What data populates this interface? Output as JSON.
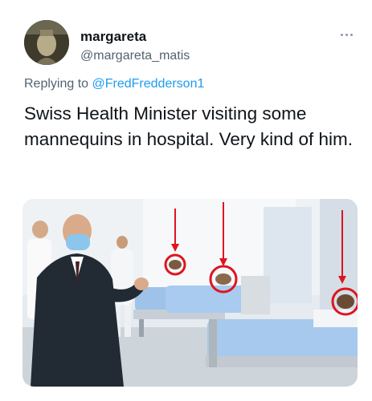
{
  "author": {
    "display_name": "margareta",
    "handle": "@margareta_matis"
  },
  "reply": {
    "prefix": "Replying to ",
    "mention": "@FredFredderson1"
  },
  "tweet": {
    "text": "Swiss Health Minister visiting some mannequins in hospital. Very kind of him."
  },
  "icons": {
    "more": "more-horizontal-icon",
    "avatar": "avatar-image"
  },
  "colors": {
    "link": "#1d9bf0",
    "secondary_text": "#536471",
    "annotation": "#e0141e"
  }
}
